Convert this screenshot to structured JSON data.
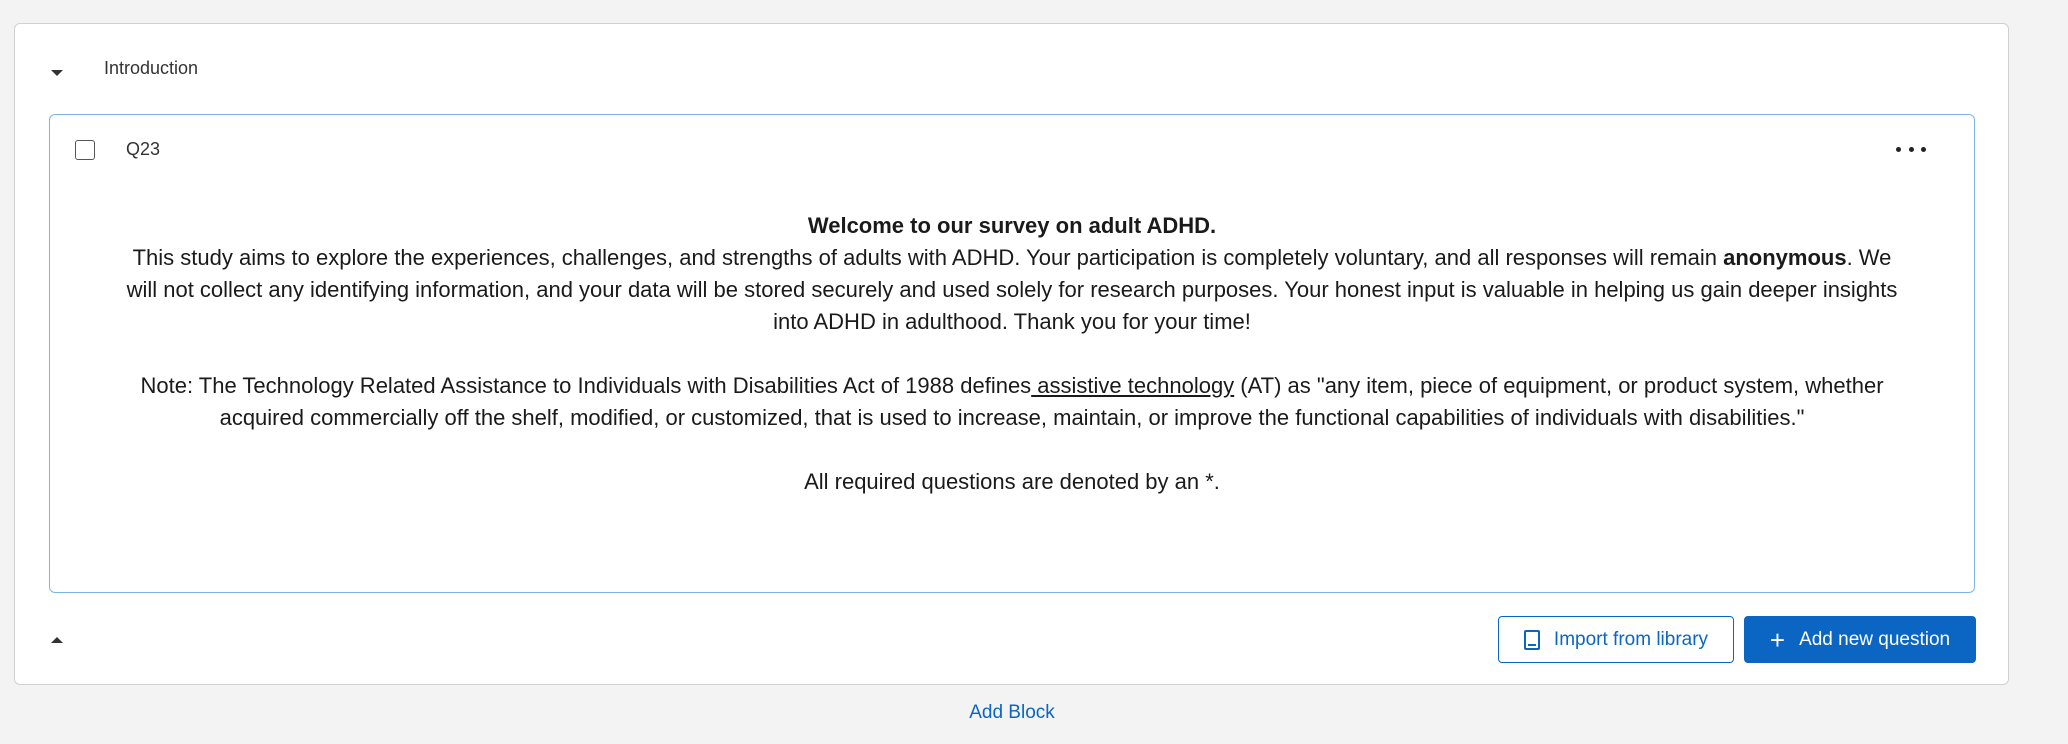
{
  "block": {
    "title": "Introduction"
  },
  "question": {
    "id": "Q23",
    "heading": "Welcome to our survey on adult ADHD.",
    "intro_before_bold": "This study aims to explore the experiences, challenges, and strengths of adults with ADHD. Your participation is completely voluntary, and all responses will remain ",
    "intro_bold": "anonymous",
    "intro_after_bold": ". We will not collect any identifying information, and your data will be stored securely and used solely for research purposes. Your honest input is valuable in helping us gain deeper insights into ADHD in adulthood. Thank you for your time!",
    "note_before_link": "Note: The Technology Related Assistance to Individuals with Disabilities Act of 1988 defines",
    "note_link": " assistive technology",
    "note_after_link": " (AT) as \"any item, piece of equipment, or product system, whether acquired commercially off the shelf, modified, or customized, that is used to increase, maintain, or improve the functional capabilities of individuals with disabilities.\"",
    "required_note": "All required questions are denoted by an *."
  },
  "actions": {
    "import_label": "Import from library",
    "add_label": "Add new question",
    "add_block_label": "Add Block"
  },
  "icons": {
    "collapse": "caret-down-icon",
    "expand": "caret-up-icon",
    "menu": "more-horizontal-icon",
    "import": "book-icon",
    "add": "plus-icon"
  },
  "colors": {
    "accent": "#0b66c3",
    "question_border": "#7fb3e6"
  }
}
